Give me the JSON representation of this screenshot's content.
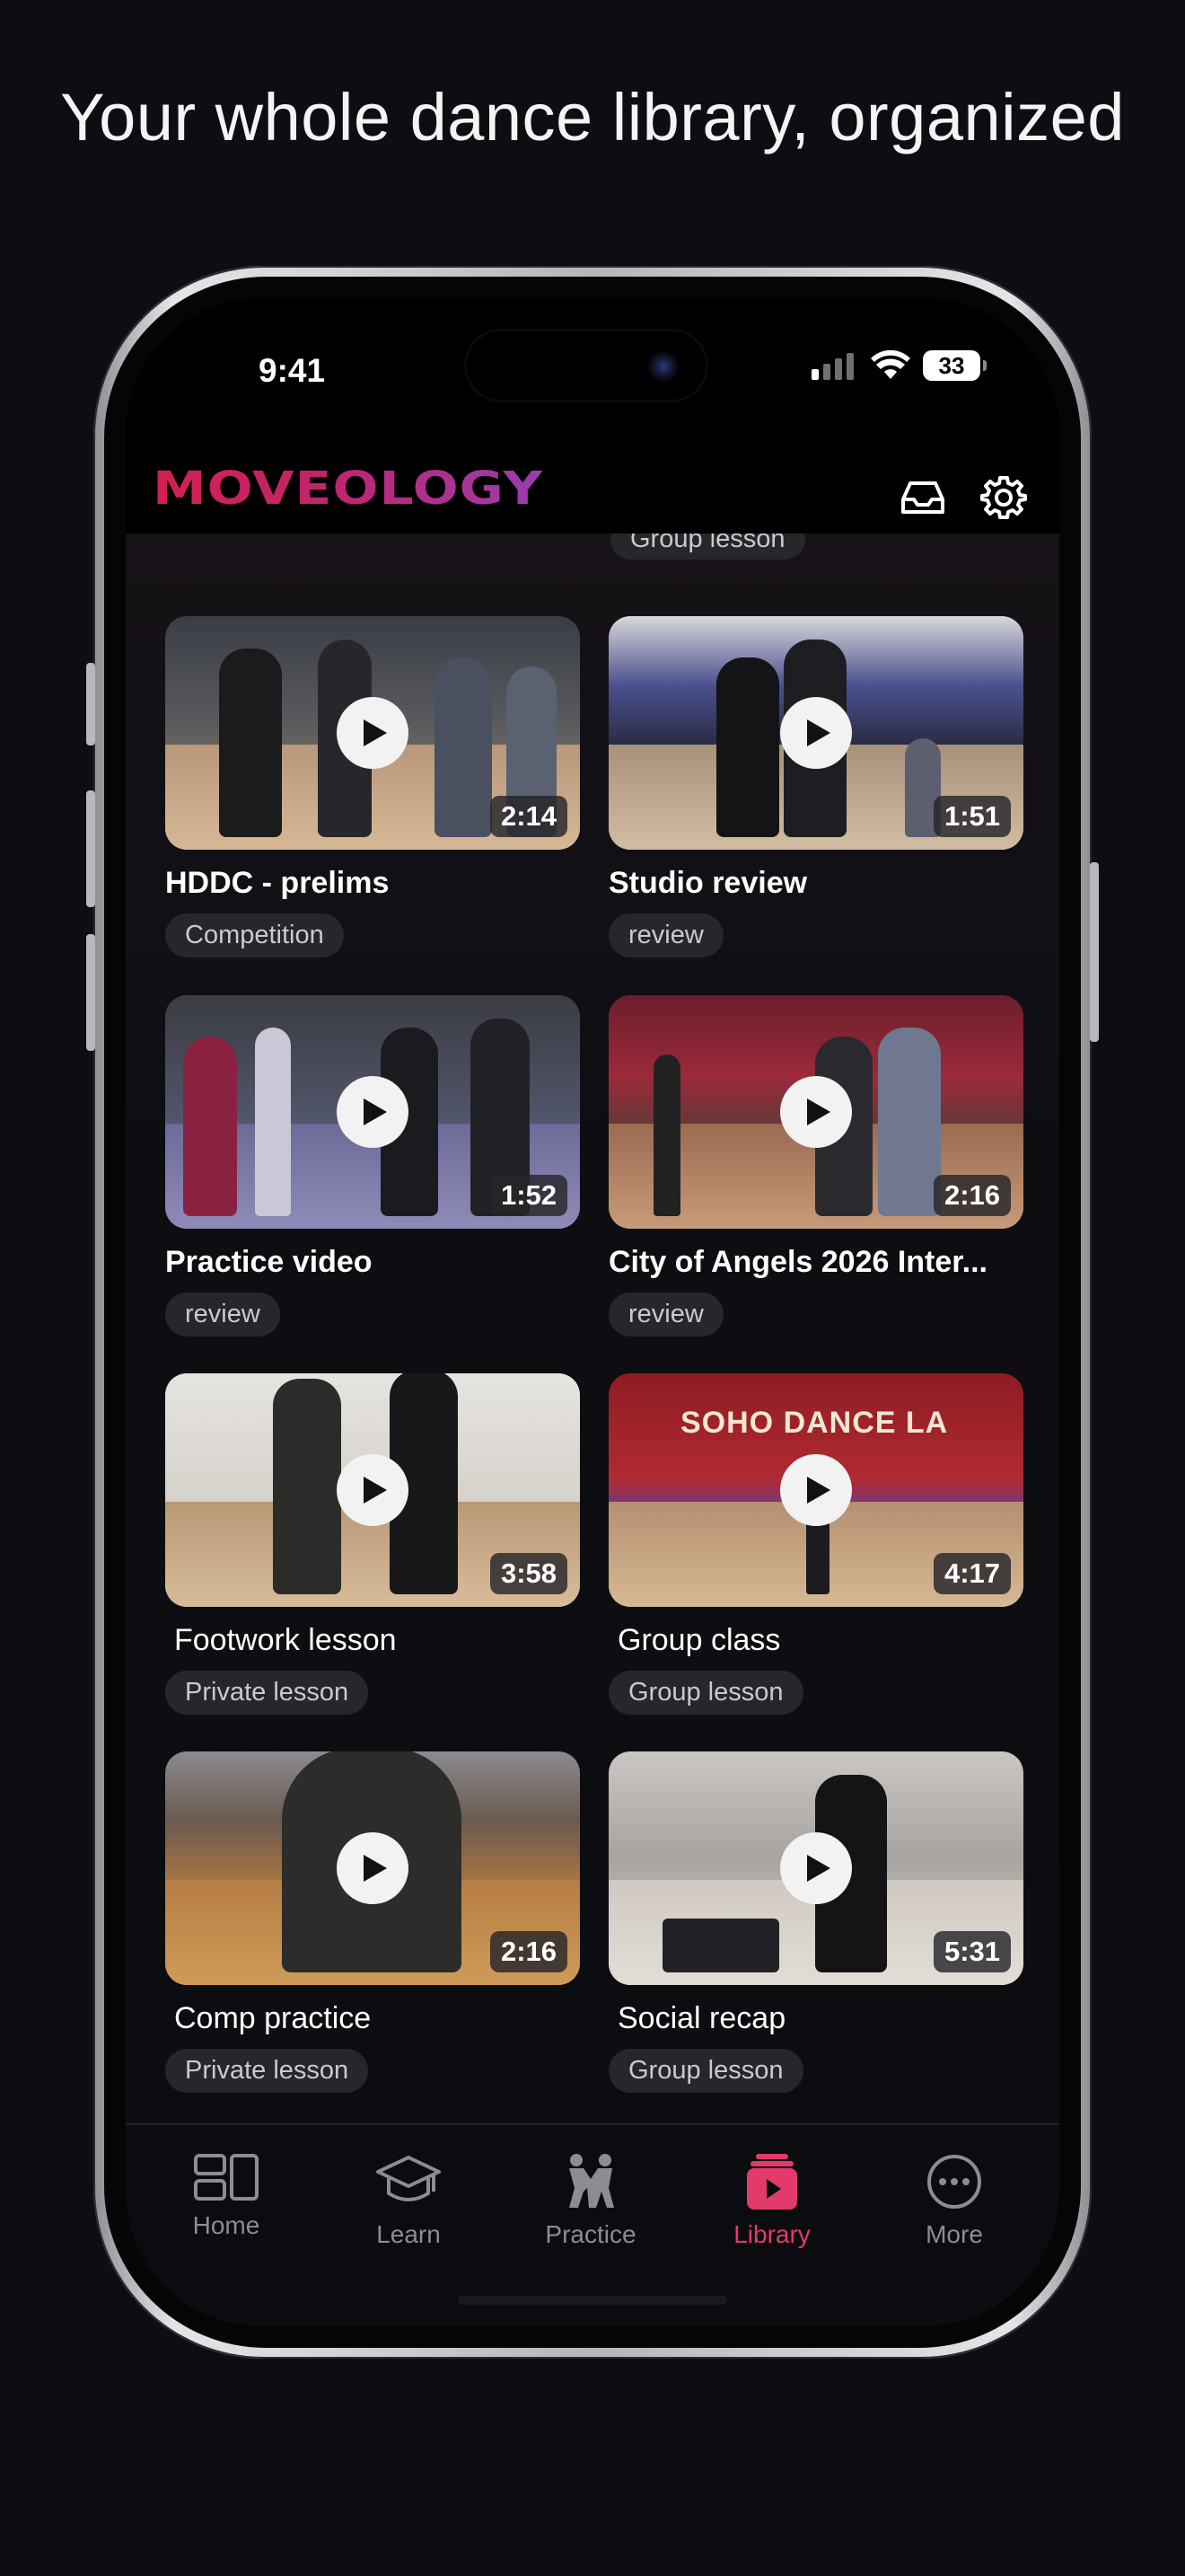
{
  "headline": "Your whole dance library, organized",
  "status": {
    "time": "9:41",
    "battery": "33"
  },
  "app": {
    "logo_text": "MOVEOLOGY"
  },
  "header_icons": [
    "inbox-icon",
    "settings-gear-icon"
  ],
  "peek_tag": "Group lesson",
  "videos": [
    {
      "title": "HDDC - prelims",
      "duration": "2:14",
      "tag": "Competition"
    },
    {
      "title": "Studio review",
      "duration": "1:51",
      "tag": "review"
    },
    {
      "title": "Practice video",
      "duration": "1:52",
      "tag": "review"
    },
    {
      "title": "City of Angels 2026 Inter...",
      "duration": "2:16",
      "tag": "review"
    },
    {
      "title": "Footwork lesson",
      "duration": "3:58",
      "tag": "Private lesson"
    },
    {
      "title": "Group class",
      "duration": "4:17",
      "tag": "Group lesson",
      "sign": "SOHO DANCE LA"
    },
    {
      "title": "Comp practice",
      "duration": "2:16",
      "tag": "Private lesson"
    },
    {
      "title": "Social recap",
      "duration": "5:31",
      "tag": "Group lesson"
    }
  ],
  "tabs": [
    {
      "label": "Home",
      "icon": "home-layout-icon",
      "active": false
    },
    {
      "label": "Learn",
      "icon": "graduation-cap-icon",
      "active": false
    },
    {
      "label": "Practice",
      "icon": "dancing-couple-icon",
      "active": false
    },
    {
      "label": "Library",
      "icon": "video-library-icon",
      "active": true
    },
    {
      "label": "More",
      "icon": "more-ellipsis-icon",
      "active": false
    }
  ],
  "colors": {
    "accent": "#e23a6a",
    "background": "#0d0e11",
    "tag_bg": "#26272c"
  }
}
